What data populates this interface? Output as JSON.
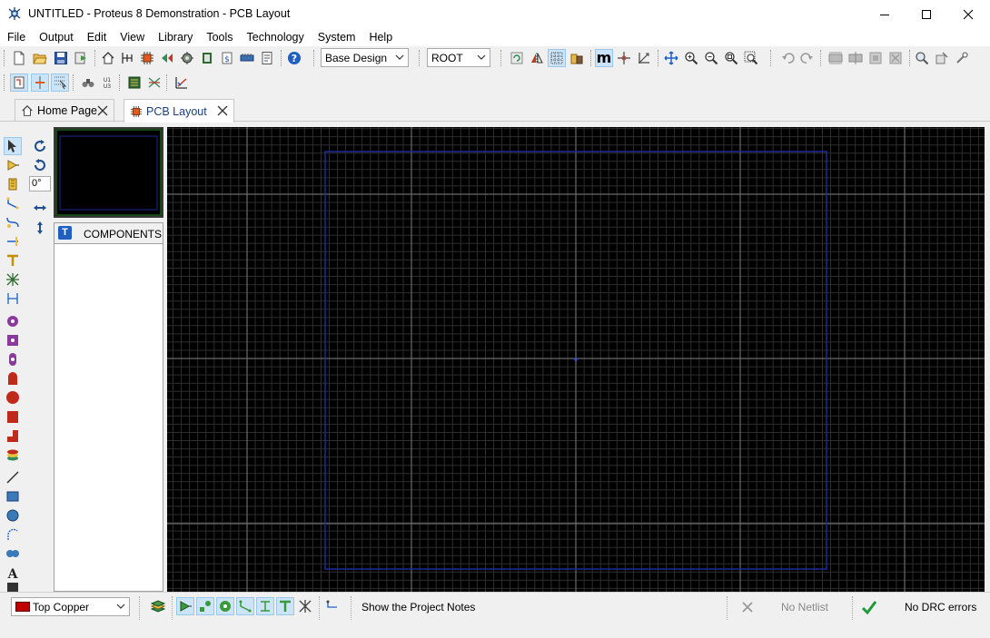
{
  "window": {
    "title": "UNTITLED - Proteus 8 Demonstration - PCB Layout"
  },
  "menu": [
    "File",
    "Output",
    "Edit",
    "View",
    "Library",
    "Tools",
    "Technology",
    "System",
    "Help"
  ],
  "toolbar": {
    "variant_select": "Base Design",
    "level_select": "ROOT",
    "snap_label": "m"
  },
  "tabs": [
    {
      "label": "Home Page",
      "active": false
    },
    {
      "label": "PCB Layout",
      "active": true
    }
  ],
  "left_panel": {
    "rotation_angle": "0°",
    "selector_header_letter": "T",
    "selector_header_label": "COMPONENTS"
  },
  "status": {
    "layer_select": "Top Copper",
    "layer_color": "#c00000",
    "message": "Show the Project Notes",
    "netlist_status": "No Netlist",
    "drc_status": "No DRC errors"
  },
  "colors": {
    "canvas_bg": "#000000",
    "board_outline": "#1e2a96",
    "grid_minor": "#2e2e2e",
    "grid_major": "#6a6a6a",
    "accent": "#1a5fb4"
  }
}
